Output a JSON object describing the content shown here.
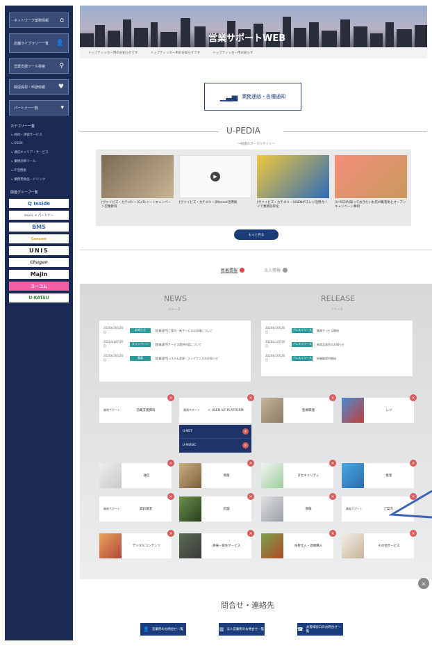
{
  "sidebar": {
    "buttons": [
      {
        "label": "ネットワーク業務情報",
        "icon": "home-icon"
      },
      {
        "label": "店舗ライブラリー一覧",
        "icon": "person-icon"
      },
      {
        "label": "営業支援ツール検索",
        "icon": "search-icon"
      },
      {
        "label": "販促資材・申請依頼",
        "icon": "heart-icon"
      },
      {
        "label": "パートナー一覧",
        "icon": "chevron-down-icon"
      }
    ],
    "category_heading": "カテゴリー一覧",
    "category_links": [
      "商材・評価サービス",
      "USEN",
      "通信キャリア・サービス",
      "業務効率ツール",
      "IT活用術",
      "業務用食品・ドリンク"
    ],
    "group_heading": "関連グループ一覧",
    "logos": [
      "Q Inside",
      "music + パートナー",
      "BMS",
      "Cancom",
      "UNIS",
      "Chugen",
      "Majin",
      "ユーコム",
      "U-KATSU"
    ]
  },
  "header": {
    "title": "営業サポートWEB",
    "links": [
      "トップティッカー用のお知らせです",
      "トップティッカー用のお知らせです",
      "トップティッカー用お知らせ"
    ]
  },
  "report_button": {
    "label": "業務連絡・各種通知",
    "icon": "bar-chart-icon"
  },
  "upedia": {
    "title": "U-PEDIA",
    "subtitle": "〜知識のポータルサイト〜",
    "cards": [
      {
        "caption": "[ヴァイビズ・カテゴリー]GoToイートキャンペーン営業教育"
      },
      {
        "caption": "[ヴァイビズ・カテゴリー]Mennet活用術"
      },
      {
        "caption": "[ヴァイビズ・カテゴリー]USENポスレジ活用ガイドで業務効率化"
      },
      {
        "caption": "[U-PEDIA]知っておきたいお店の集客術とオープンキャンペーン事例"
      }
    ],
    "see_more_label": "もっと見る"
  },
  "tabs": [
    {
      "label": "新着情報",
      "active": true
    },
    {
      "label": "法人情報",
      "active": false
    }
  ],
  "news": {
    "title": "NEWS",
    "subtitle": "ニュース",
    "items": [
      {
        "date": "2020年10月20日",
        "badge": "お知らせ",
        "text": "[営業部門]ご案内・新サービスの詳細について"
      },
      {
        "date": "2020年10月20日",
        "badge": "キャンペーン",
        "text": "[営業部門]サービス提供内容について"
      },
      {
        "date": "2020年10月20日",
        "badge": "重要",
        "text": "[営業部門]システム変更・メンテナンスのお知らせ"
      }
    ]
  },
  "release": {
    "title": "RELEASE",
    "subtitle": "リリース",
    "items": [
      {
        "date": "2020年10月20日",
        "badge": "プレスリリース",
        "text": "業務サービス開始"
      },
      {
        "date": "2020年10月20日",
        "badge": "プレスリリース",
        "text": "新商品発売のお知らせ"
      },
      {
        "date": "2020年10月20日",
        "badge": "プレスリリース",
        "text": "新機能提供開始"
      }
    ]
  },
  "tiles": [
    {
      "small": "業務サポート",
      "label": "営業支援資料"
    },
    {
      "small": "業務サポート",
      "label": "< USEN IoT PLATFORM"
    },
    {
      "small": "",
      "label": "医療関連"
    },
    {
      "small": "",
      "label": "レジ"
    },
    {
      "small": "",
      "label": "通信"
    },
    {
      "small": "",
      "label": "情報"
    },
    {
      "small": "",
      "label": "ITセキュリティ"
    },
    {
      "small": "",
      "label": "集客"
    },
    {
      "small": "業務サポート",
      "label": "資料請求"
    },
    {
      "small": "",
      "label": "店舗"
    },
    {
      "small": "",
      "label": "保険"
    },
    {
      "small": "業務サポート",
      "label": "ご案内"
    },
    {
      "small": "",
      "label": "デジタルコンテンツ"
    },
    {
      "small": "",
      "label": "清掃・衛生サービス"
    },
    {
      "small": "",
      "label": "食材仕入・酒類購入"
    },
    {
      "small": "",
      "label": "その他サービス"
    }
  ],
  "sub_dropdown": [
    "U-NET",
    "U-MUSIC"
  ],
  "contact": {
    "title": "問合せ・連絡先",
    "buttons": [
      {
        "label": "営業所のお問合せ一覧",
        "icon": "person-icon"
      },
      {
        "label": "法人営業所のお問合せ一覧",
        "icon": "building-icon"
      },
      {
        "label": "お客様窓口のお問合せ一覧",
        "icon": "phone-icon"
      }
    ]
  }
}
